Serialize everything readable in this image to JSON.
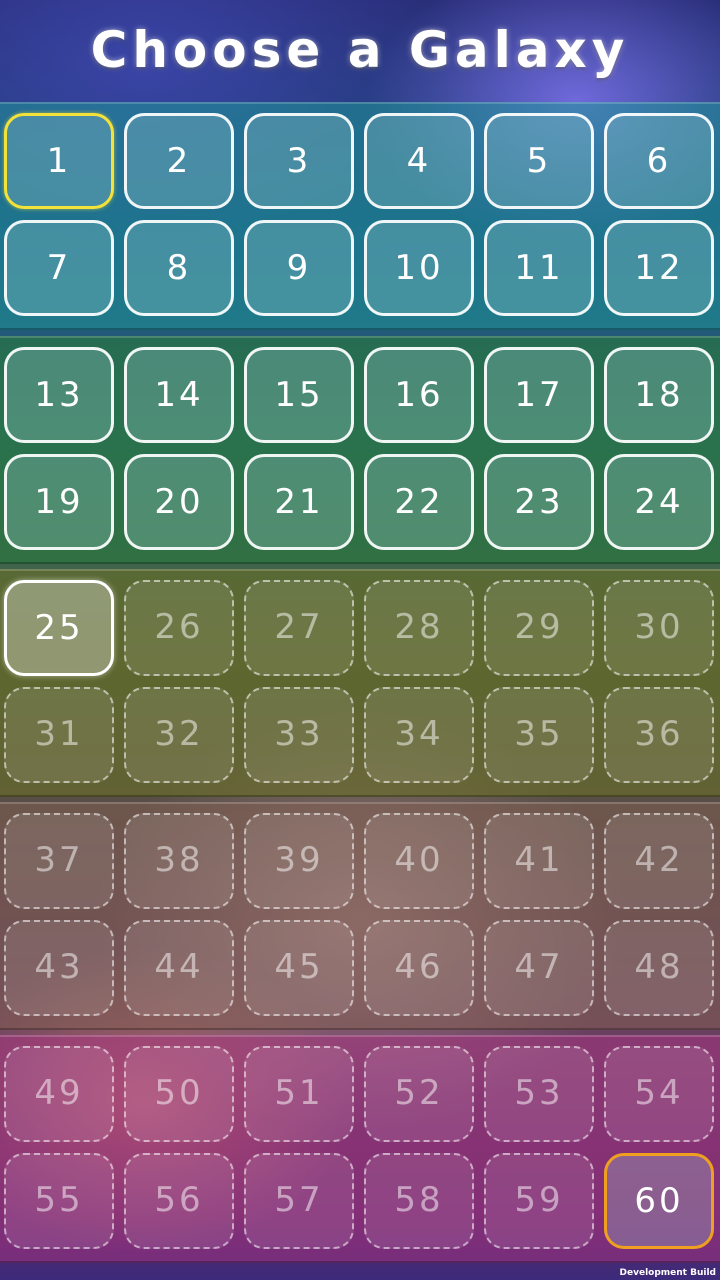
{
  "title": "Choose a Galaxy",
  "footer": "Development Build",
  "colors": {
    "band_teal": "#1e9696",
    "band_green": "#287838",
    "band_olive": "#696e28",
    "band_brown": "#825f50",
    "band_magenta": "#aa3282",
    "selected_border": "#f2e23a",
    "highlight_border": "#f0a020"
  },
  "bands": [
    {
      "tiles": [
        {
          "label": "1",
          "state": "selected"
        },
        {
          "label": "2",
          "state": "unlocked"
        },
        {
          "label": "3",
          "state": "unlocked"
        },
        {
          "label": "4",
          "state": "unlocked"
        },
        {
          "label": "5",
          "state": "unlocked"
        },
        {
          "label": "6",
          "state": "unlocked"
        },
        {
          "label": "7",
          "state": "unlocked"
        },
        {
          "label": "8",
          "state": "unlocked"
        },
        {
          "label": "9",
          "state": "unlocked"
        },
        {
          "label": "10",
          "state": "unlocked"
        },
        {
          "label": "11",
          "state": "unlocked"
        },
        {
          "label": "12",
          "state": "unlocked"
        }
      ]
    },
    {
      "tiles": [
        {
          "label": "13",
          "state": "unlocked"
        },
        {
          "label": "14",
          "state": "unlocked"
        },
        {
          "label": "15",
          "state": "unlocked"
        },
        {
          "label": "16",
          "state": "unlocked"
        },
        {
          "label": "17",
          "state": "unlocked"
        },
        {
          "label": "18",
          "state": "unlocked"
        },
        {
          "label": "19",
          "state": "unlocked"
        },
        {
          "label": "20",
          "state": "unlocked"
        },
        {
          "label": "21",
          "state": "unlocked"
        },
        {
          "label": "22",
          "state": "unlocked"
        },
        {
          "label": "23",
          "state": "unlocked"
        },
        {
          "label": "24",
          "state": "unlocked"
        }
      ]
    },
    {
      "tiles": [
        {
          "label": "25",
          "state": "current"
        },
        {
          "label": "26",
          "state": "locked"
        },
        {
          "label": "27",
          "state": "locked"
        },
        {
          "label": "28",
          "state": "locked"
        },
        {
          "label": "29",
          "state": "locked"
        },
        {
          "label": "30",
          "state": "locked"
        },
        {
          "label": "31",
          "state": "locked"
        },
        {
          "label": "32",
          "state": "locked"
        },
        {
          "label": "33",
          "state": "locked"
        },
        {
          "label": "34",
          "state": "locked"
        },
        {
          "label": "35",
          "state": "locked"
        },
        {
          "label": "36",
          "state": "locked"
        }
      ]
    },
    {
      "tiles": [
        {
          "label": "37",
          "state": "locked"
        },
        {
          "label": "38",
          "state": "locked"
        },
        {
          "label": "39",
          "state": "locked"
        },
        {
          "label": "40",
          "state": "locked"
        },
        {
          "label": "41",
          "state": "locked"
        },
        {
          "label": "42",
          "state": "locked"
        },
        {
          "label": "43",
          "state": "locked"
        },
        {
          "label": "44",
          "state": "locked"
        },
        {
          "label": "45",
          "state": "locked"
        },
        {
          "label": "46",
          "state": "locked"
        },
        {
          "label": "47",
          "state": "locked"
        },
        {
          "label": "48",
          "state": "locked"
        }
      ]
    },
    {
      "tiles": [
        {
          "label": "49",
          "state": "locked"
        },
        {
          "label": "50",
          "state": "locked"
        },
        {
          "label": "51",
          "state": "locked"
        },
        {
          "label": "52",
          "state": "locked"
        },
        {
          "label": "53",
          "state": "locked"
        },
        {
          "label": "54",
          "state": "locked"
        },
        {
          "label": "55",
          "state": "locked"
        },
        {
          "label": "56",
          "state": "locked"
        },
        {
          "label": "57",
          "state": "locked"
        },
        {
          "label": "58",
          "state": "locked"
        },
        {
          "label": "59",
          "state": "locked"
        },
        {
          "label": "60",
          "state": "highlight"
        }
      ]
    }
  ]
}
